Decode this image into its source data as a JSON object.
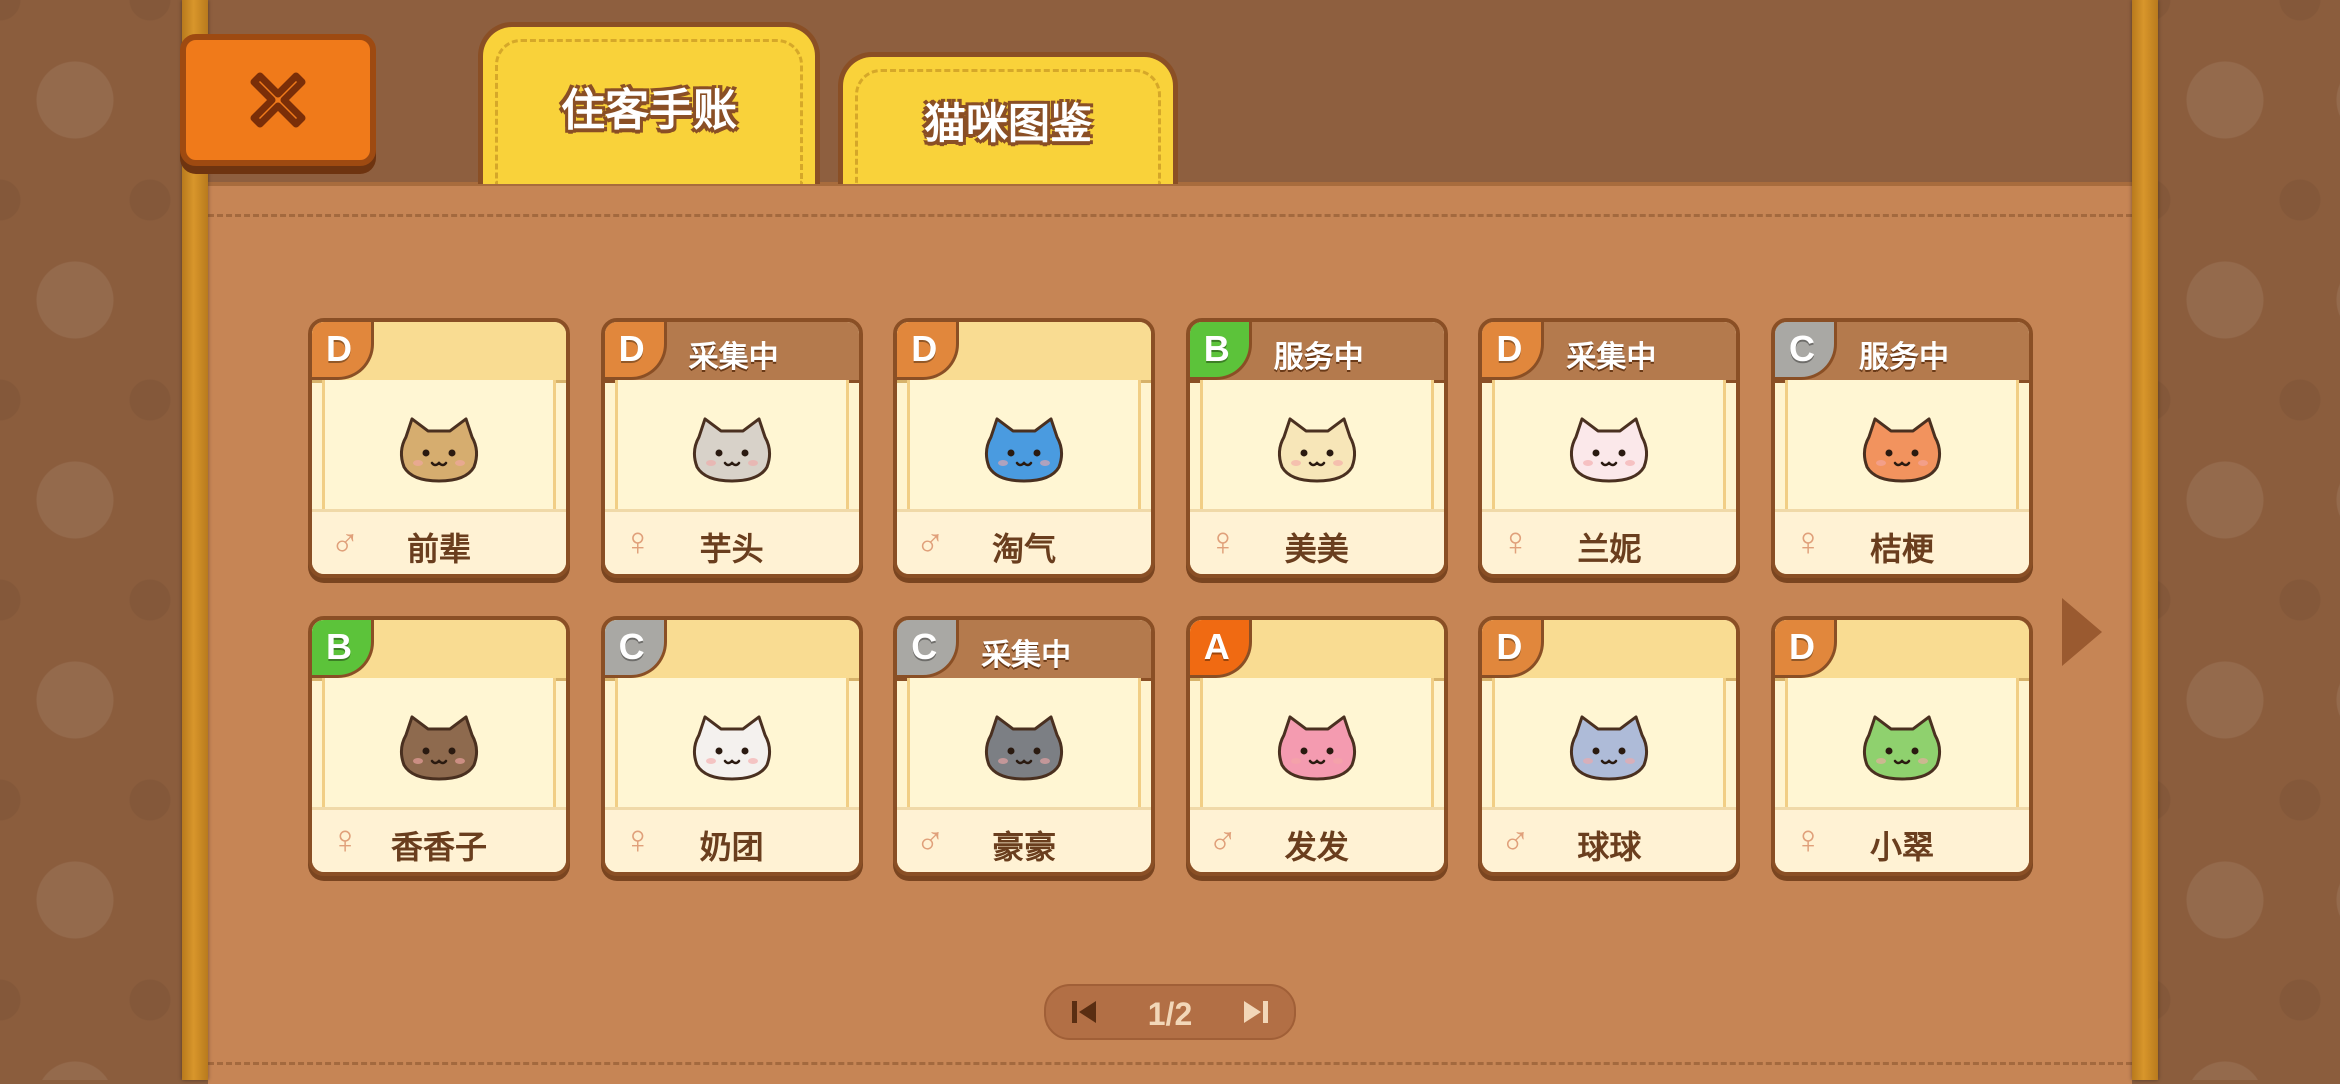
{
  "tabs": {
    "active": "住客手账",
    "inactive": "猫咪图鉴"
  },
  "pager": {
    "label": "1/2"
  },
  "cats": [
    {
      "grade": "D",
      "status": "",
      "name": "前辈",
      "gender": "♂",
      "color": "#d6ad6f"
    },
    {
      "grade": "D",
      "status": "采集中",
      "name": "芋头",
      "gender": "♀",
      "color": "#d8d2c9"
    },
    {
      "grade": "D",
      "status": "",
      "name": "淘气",
      "gender": "♂",
      "color": "#4a9be0"
    },
    {
      "grade": "B",
      "status": "服务中",
      "name": "美美",
      "gender": "♀",
      "color": "#f7e6b8"
    },
    {
      "grade": "D",
      "status": "采集中",
      "name": "兰妮",
      "gender": "♀",
      "color": "#fbe8ea"
    },
    {
      "grade": "C",
      "status": "服务中",
      "name": "桔梗",
      "gender": "♀",
      "color": "#f2935e"
    },
    {
      "grade": "B",
      "status": "",
      "name": "香香子",
      "gender": "♀",
      "color": "#8e6a4e"
    },
    {
      "grade": "C",
      "status": "",
      "name": "奶团",
      "gender": "♀",
      "color": "#f4f1ee"
    },
    {
      "grade": "C",
      "status": "采集中",
      "name": "豪豪",
      "gender": "♂",
      "color": "#7c7f84"
    },
    {
      "grade": "A",
      "status": "",
      "name": "发发",
      "gender": "♂",
      "color": "#f49bb0"
    },
    {
      "grade": "D",
      "status": "",
      "name": "球球",
      "gender": "♂",
      "color": "#aebbd8"
    },
    {
      "grade": "D",
      "status": "",
      "name": "小翠",
      "gender": "♀",
      "color": "#8fd16e"
    }
  ],
  "colors": {
    "tab_yellow": "#f9d23a",
    "close_orange": "#f07a1a",
    "panel": "#c68555"
  }
}
